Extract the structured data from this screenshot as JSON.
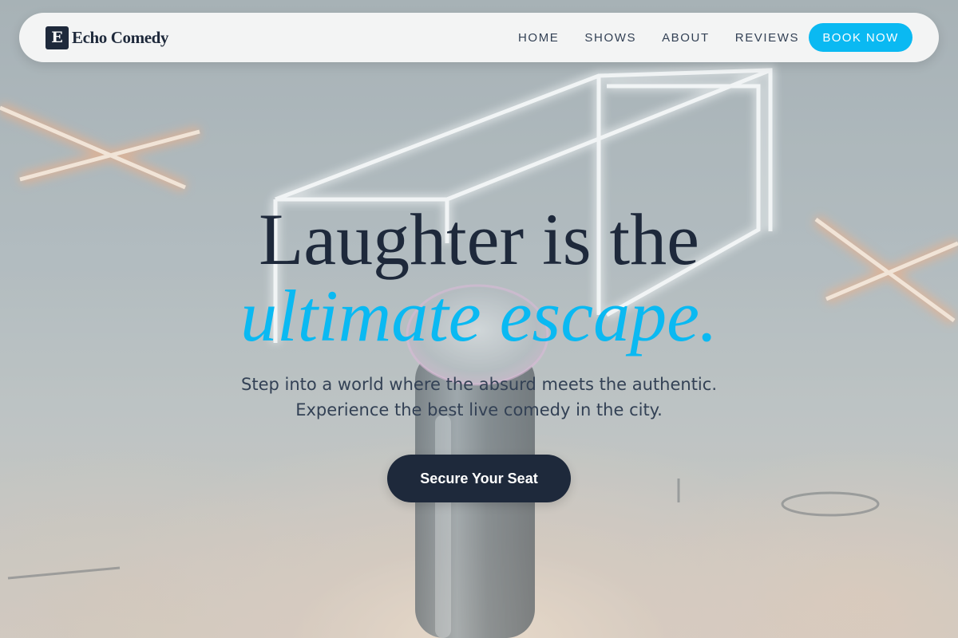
{
  "brand": {
    "logo_letter": "E",
    "name": "Echo Comedy"
  },
  "nav": {
    "items": [
      {
        "label": "HOME"
      },
      {
        "label": "SHOWS"
      },
      {
        "label": "ABOUT"
      },
      {
        "label": "REVIEWS"
      }
    ],
    "cta_label": "BOOK NOW"
  },
  "hero": {
    "title_line1": "Laughter is the",
    "title_line2": "ultimate escape.",
    "subtitle_line1": "Step into a world where the absurd meets the authentic.",
    "subtitle_line2": "Experience the best live comedy in the city.",
    "cta_label": "Secure Your Seat",
    "background_image": "stage-microphone-neon-photo"
  },
  "colors": {
    "accent": "#0ab9f2",
    "dark": "#1e293b",
    "text_muted": "#334155",
    "nav_bg": "#f6f7f7"
  }
}
